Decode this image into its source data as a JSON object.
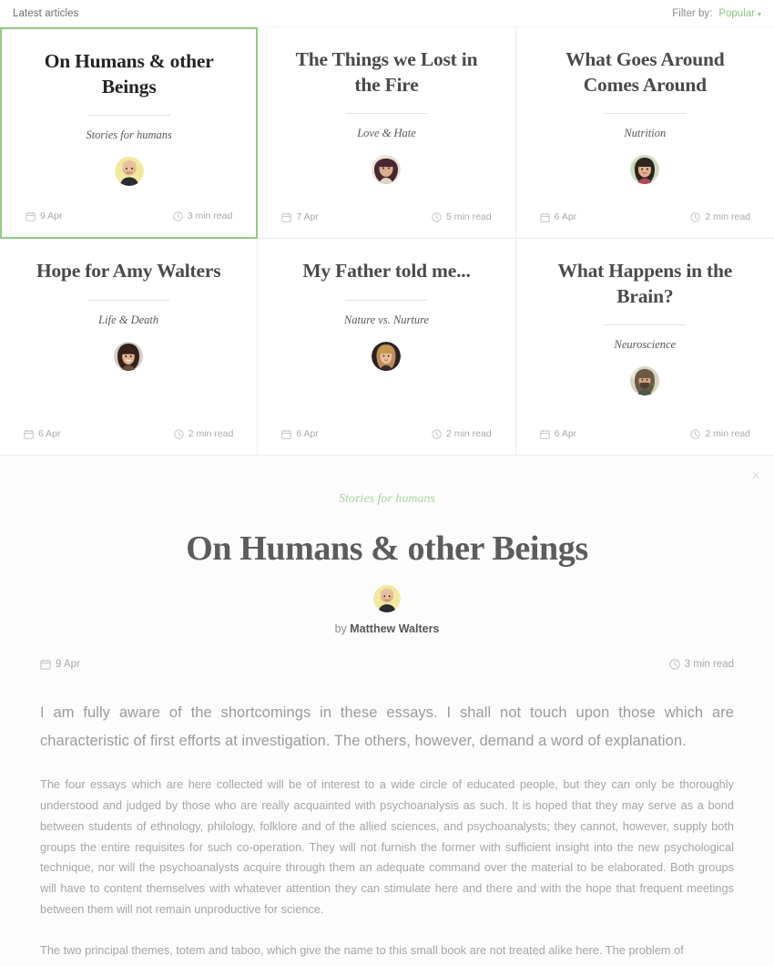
{
  "header": {
    "title": "Latest articles",
    "filter_label": "Filter by:",
    "filter_value": "Popular",
    "caret": "▾",
    "accent_green": "#8cc77f"
  },
  "cards": [
    {
      "title": "On Humans & other Beings",
      "category": "Stories for humans",
      "date": "9 Apr",
      "read_time": "3 min read",
      "selected": true,
      "avatar_name": "avatar-matthew-walters"
    },
    {
      "title": "The Things we Lost in the Fire",
      "category": "Love & Hate",
      "date": "7 Apr",
      "read_time": "5 min read",
      "selected": false,
      "avatar_name": "avatar-author-2"
    },
    {
      "title": "What Goes Around Comes Around",
      "category": "Nutrition",
      "date": "6 Apr",
      "read_time": "2 min read",
      "selected": false,
      "avatar_name": "avatar-author-3"
    },
    {
      "title": "Hope for Amy Walters",
      "category": "Life & Death",
      "date": "6 Apr",
      "read_time": "2 min read",
      "selected": false,
      "avatar_name": "avatar-author-4"
    },
    {
      "title": "My Father told me...",
      "category": "Nature vs. Nurture",
      "date": "6 Apr",
      "read_time": "2 min read",
      "selected": false,
      "avatar_name": "avatar-author-5"
    },
    {
      "title": "What Happens in the Brain?",
      "category": "Neuroscience",
      "date": "6 Apr",
      "read_time": "2 min read",
      "selected": false,
      "avatar_name": "avatar-author-6"
    }
  ],
  "article": {
    "close_label": "×",
    "category": "Stories for humans",
    "title": "On Humans & other Beings",
    "by_prefix": "by",
    "author": "Matthew Walters",
    "date": "9 Apr",
    "read_time": "3 min read",
    "lead": "I am fully aware of the shortcomings in these essays. I shall not touch upon those which are characteristic of first efforts at investigation. The others, however, demand a word of explanation.",
    "paragraph_1": "The four essays which are here collected will be of interest to a wide circle of educated people, but they can only be thoroughly understood and judged by those who are really acquainted with psychoanalysis as such. It is hoped that they may serve as a bond between students of ethnology, philology, folklore and of the allied sciences, and psychoanalysts; they cannot, however, supply both groups the entire requisites for such co-operation. They will not furnish the former with sufficient insight into the new psychological technique, nor will the psychoanalysts acquire through them an adequate command over the material to be elaborated. Both groups will have to content themselves with whatever attention they can stimulate here and there and with the hope that frequent meetings between them will not remain unproductive for science.",
    "paragraph_2": "The two principal themes, totem and taboo, which give the name to this small book are not treated alike here. The problem of"
  }
}
